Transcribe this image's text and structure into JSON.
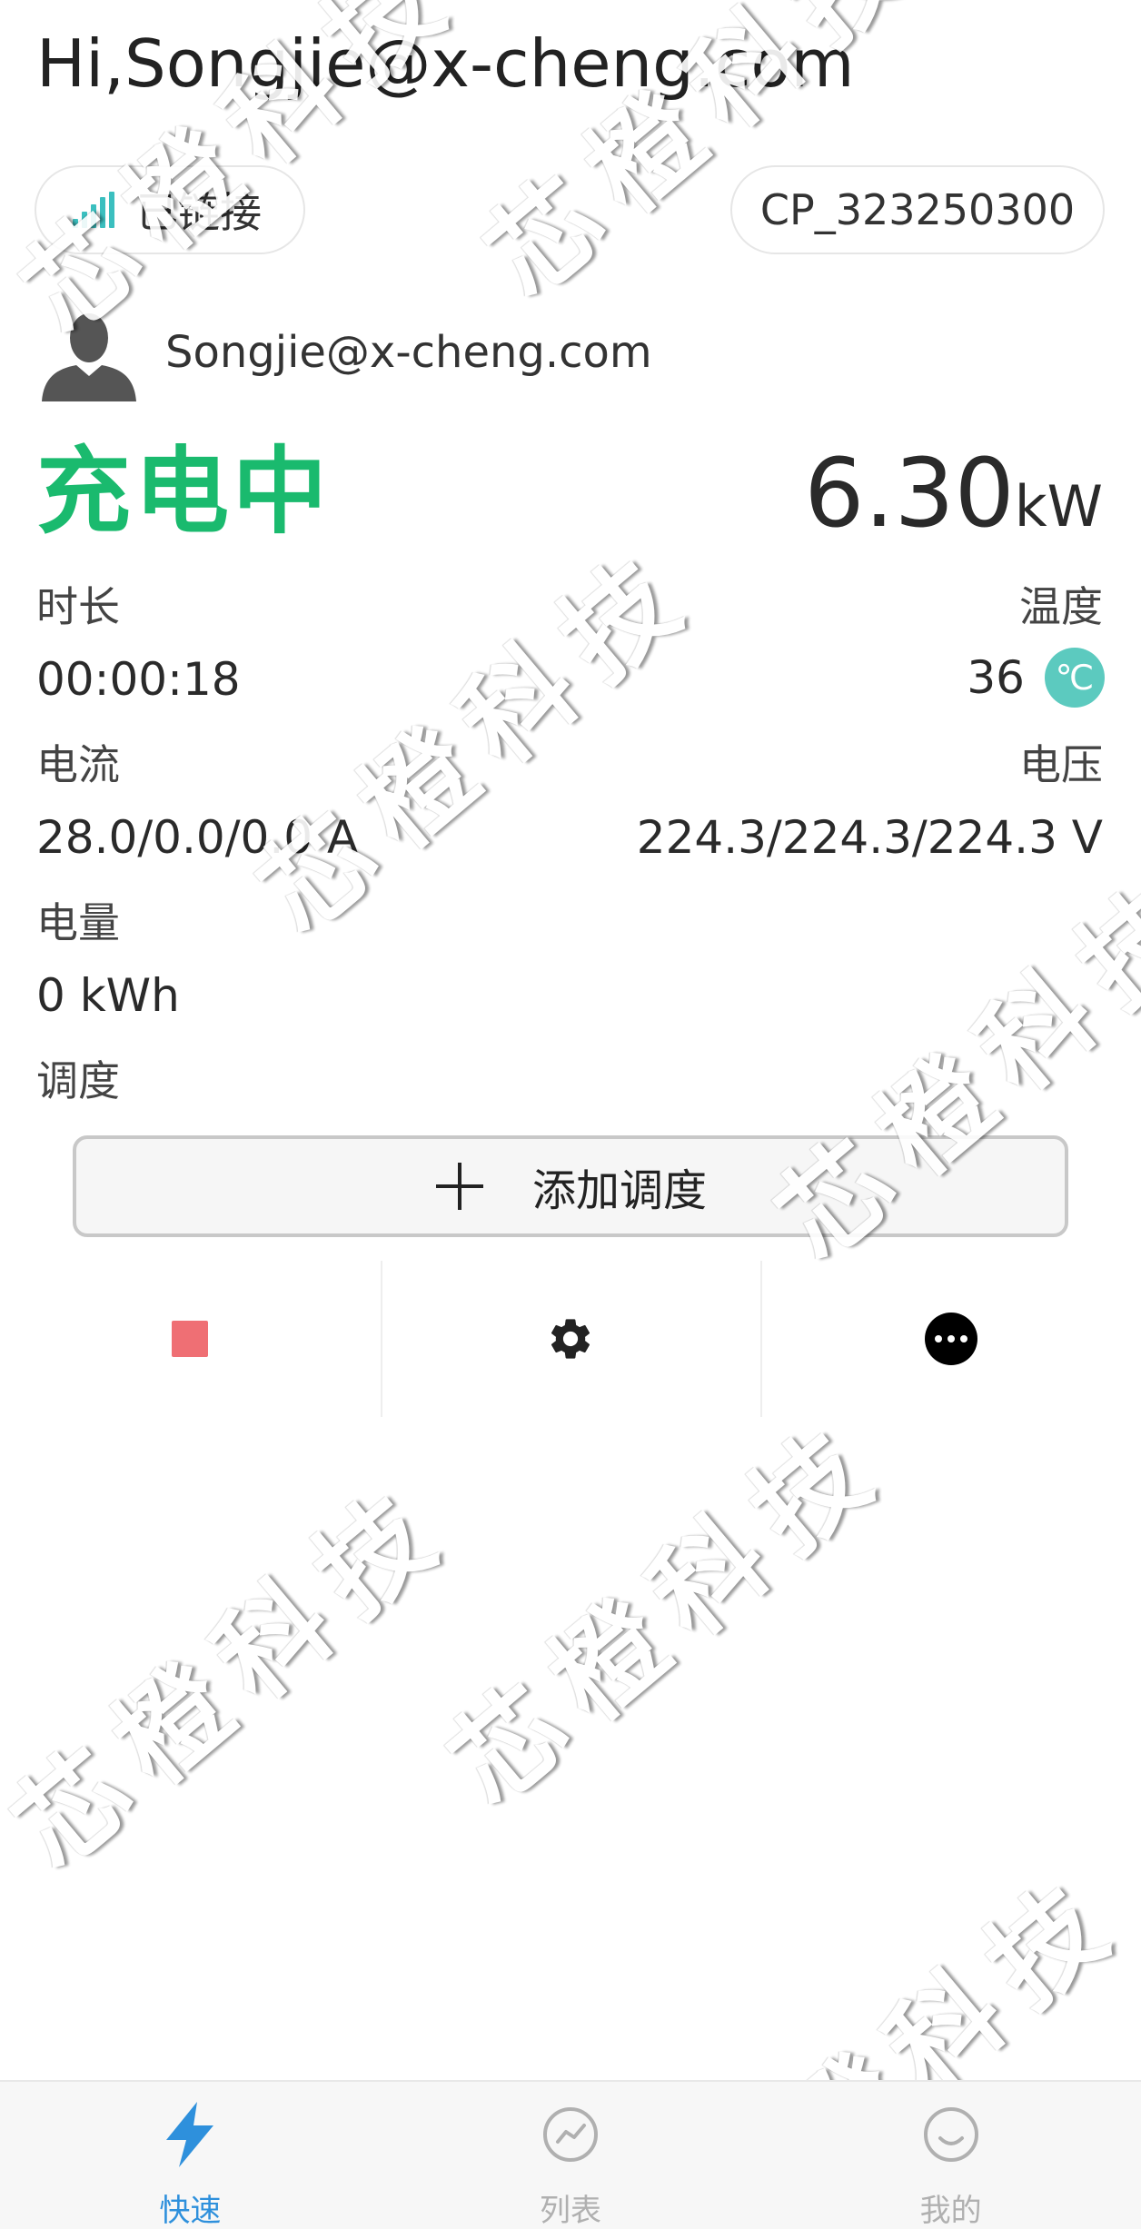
{
  "header": {
    "greeting": "Hi,Songjie@x-cheng.com"
  },
  "connection": {
    "status_label": "已链接",
    "icon": "signal-bars-icon",
    "device_id": "CP_323250300"
  },
  "user": {
    "avatar_icon": "user-silhouette-icon",
    "email": "Songjie@x-cheng.com"
  },
  "charging": {
    "status": "充电中",
    "status_color": "#1aba6e",
    "power_value": "6.30",
    "power_unit": "kW",
    "duration_label": "时长",
    "duration_value": "00:00:18",
    "temperature_label": "温度",
    "temperature_value": "36",
    "temperature_unit": "℃",
    "current_label": "电流",
    "current_value": "28.0/0.0/0.0 A",
    "voltage_label": "电压",
    "voltage_value": "224.3/224.3/224.3 V",
    "energy_label": "电量",
    "energy_value": "0 kWh",
    "schedule_label": "调度"
  },
  "schedule_button": {
    "icon": "plus-icon",
    "label": "添加调度"
  },
  "actions": [
    {
      "icon": "stop-icon",
      "color": "#ef6f74"
    },
    {
      "icon": "gear-icon"
    },
    {
      "icon": "more-icon"
    }
  ],
  "watermark": {
    "text": "芯橙科技"
  },
  "tabbar": {
    "active_color": "#2e90dc",
    "items": [
      {
        "label": "快速",
        "icon": "lightning-icon",
        "active": true
      },
      {
        "label": "列表",
        "icon": "chart-circle-icon",
        "active": false
      },
      {
        "label": "我的",
        "icon": "smile-icon",
        "active": false
      }
    ]
  }
}
